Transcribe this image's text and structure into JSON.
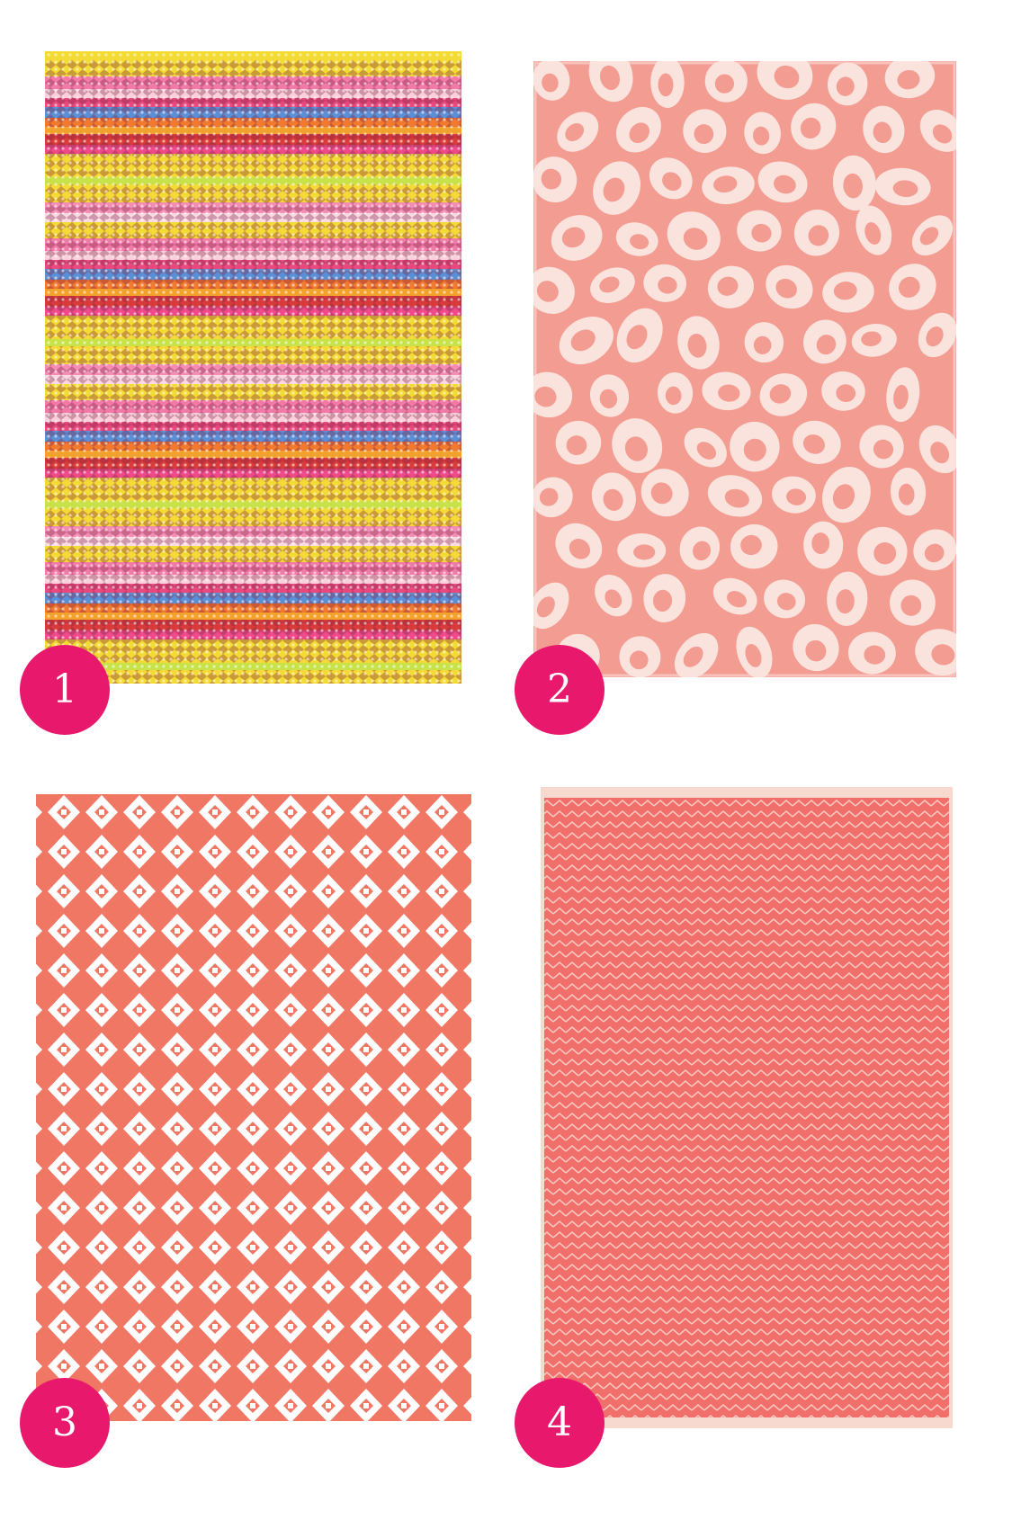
{
  "products": [
    {
      "number": "1",
      "pattern": "multicolor-stripe",
      "color": "#f3d838"
    },
    {
      "number": "2",
      "pattern": "leopard-spots",
      "color": "#f29a92"
    },
    {
      "number": "3",
      "pattern": "diamond-lattice",
      "color": "#ef7763"
    },
    {
      "number": "4",
      "pattern": "herringbone",
      "color": "#f06f6a"
    }
  ],
  "badge_color": "#e8196c"
}
